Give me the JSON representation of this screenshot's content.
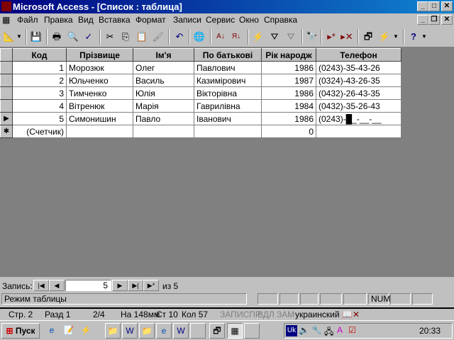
{
  "window": {
    "title": "Microsoft Access - [Список : таблица]"
  },
  "menu": [
    "Файл",
    "Правка",
    "Вид",
    "Вставка",
    "Формат",
    "Записи",
    "Сервис",
    "Окно",
    "Справка"
  ],
  "table": {
    "columns": [
      "Код",
      "Прізвище",
      "Ім'я",
      "По батькові",
      "Рік народж",
      "Телефон"
    ],
    "rows": [
      [
        "1",
        "Морозюк",
        "Олег",
        "Павлович",
        "1986",
        "(0243)-35-43-26"
      ],
      [
        "2",
        "Юльченко",
        "Василь",
        "Казимірович",
        "1987",
        "(0324)-43-26-35"
      ],
      [
        "3",
        "Тимченко",
        "Юлія",
        "Вікторівна",
        "1986",
        "(0432)-26-43-35"
      ],
      [
        "4",
        "Вітренюк",
        "Марія",
        "Гаврилівна",
        "1984",
        "(0432)-35-26-43"
      ],
      [
        "5",
        "Симонишин",
        "Павло",
        "Іванович",
        "1986",
        "(0243)-█_-__-__"
      ]
    ],
    "new_row": {
      "code": "(Счетчик)",
      "year": "0"
    }
  },
  "nav": {
    "label": "Запись:",
    "current": "5",
    "of_label": "из 5"
  },
  "status": {
    "text": "Режим таблицы",
    "num": "NUM"
  },
  "word_status": {
    "page": "Стр. 2",
    "section": "Разд 1",
    "pages": "2/4",
    "at": "На 148мм",
    "line": "Ст 10",
    "col": "Кол 57",
    "rec": "ЗАП",
    "trk": "ИСПР",
    "ext": "ВДЛ",
    "ovr": "ЗАМ",
    "lang": "украинский"
  },
  "taskbar": {
    "start": "Пуск",
    "tray_lang": "Uk",
    "clock": "20:33"
  }
}
